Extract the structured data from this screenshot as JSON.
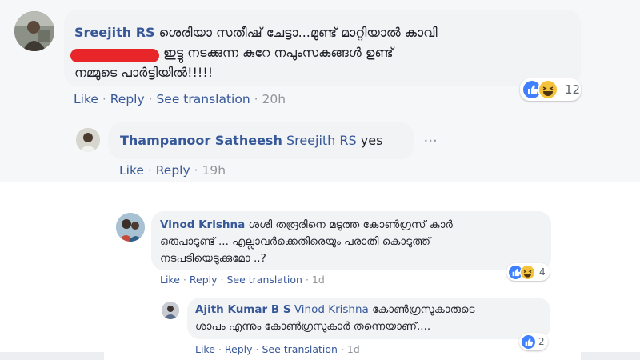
{
  "comments": [
    {
      "author": "Sreejith RS",
      "line1": "ശെരിയാ സതീഷ് ചേട്ടാ...മുണ്ട് മാറ്റിയാൽ കാവി",
      "line2": "ഇട്ടു നടക്കുന്ന കുറേ നപുംസകങ്ങൾ ഉണ്ട്",
      "line3": "നമ്മുടെ പാർട്ടിയിൽ!!!!!",
      "reaction_count": "12",
      "actions": {
        "like": "Like",
        "reply": "Reply",
        "see_translation": "See translation",
        "time": "20h"
      }
    },
    {
      "author": "Thampanoor Satheesh",
      "mention": "Sreejith RS",
      "text": "yes",
      "actions": {
        "like": "Like",
        "reply": "Reply",
        "time": "19h"
      }
    },
    {
      "author": "Vinod Krishna",
      "line1": "ശശി തരൂരിനെ മടുത്ത കോൺഗ്രസ് കാർ",
      "line2": "ഒരുപാടുണ്ട് ... എല്ലാവർക്കെതിരെയും പരാതി കൊടുത്ത്",
      "line3": "നടപടിയെടുക്കുമോ ..?",
      "reaction_count": "4",
      "actions": {
        "like": "Like",
        "reply": "Reply",
        "see_translation": "See translation",
        "time": "1d"
      }
    },
    {
      "author": "Ajith Kumar B S",
      "mention": "Vinod Krishna",
      "line1": "കോൺഗ്രസുകാരുടെ",
      "line2": "ശാപം എന്നും കോൺഗ്രസുകാർ തന്നെയാണ്....",
      "reaction_count": "2",
      "actions": {
        "like": "Like",
        "reply": "Reply",
        "see_translation": "See translation",
        "time": "1d"
      }
    }
  ],
  "separator": "·",
  "more_dots": "•••",
  "colors": {
    "link": "#365899",
    "bubble": "#f2f3f5",
    "like": "#4080ff",
    "haha": "#f5c33b",
    "redaction": "#e8262a"
  }
}
